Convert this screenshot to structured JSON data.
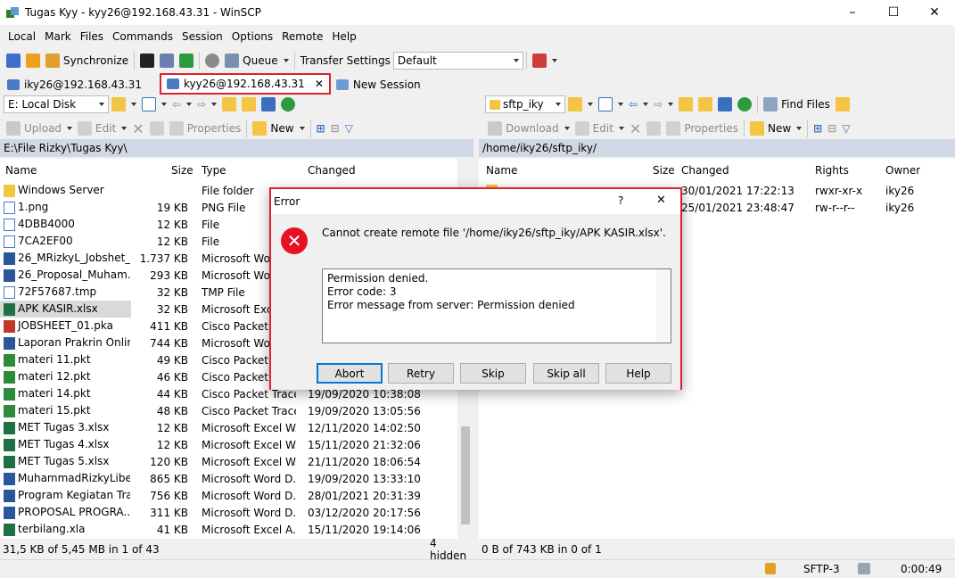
{
  "window": {
    "title": "Tugas Kyy - kyy26@192.168.43.31 - WinSCP",
    "minimize": "–",
    "maximize": "☐",
    "close": "✕"
  },
  "menu": [
    "Local",
    "Mark",
    "Files",
    "Commands",
    "Session",
    "Options",
    "Remote",
    "Help"
  ],
  "toolbar": {
    "synchronize": "Synchronize",
    "queue": "Queue",
    "transfer_settings_label": "Transfer Settings",
    "transfer_settings_value": "Default"
  },
  "tabs": [
    {
      "label": "iky26@192.168.43.31"
    },
    {
      "label": "kyy26@192.168.43.31",
      "close": "✕"
    },
    {
      "label": "New Session"
    }
  ],
  "local": {
    "drive": "E: Local Disk",
    "actions": {
      "upload": "Upload",
      "edit": "Edit",
      "properties": "Properties",
      "new": "New"
    },
    "path": "E:\\File Rizky\\Tugas Kyy\\",
    "columns": {
      "name": "Name",
      "size": "Size",
      "type": "Type",
      "changed": "Changed"
    },
    "files": [
      {
        "name": "Windows Server",
        "size": "",
        "type": "File folder",
        "changed": "",
        "icon": "folder"
      },
      {
        "name": "1.png",
        "size": "19 KB",
        "type": "PNG File",
        "changed": "",
        "icon": "doc"
      },
      {
        "name": "4DBB4000",
        "size": "12 KB",
        "type": "File",
        "changed": "",
        "icon": "doc"
      },
      {
        "name": "7CA2EF00",
        "size": "12 KB",
        "type": "File",
        "changed": "",
        "icon": "doc"
      },
      {
        "name": "26_MRizkyL_Jobshet_...",
        "size": "1.737 KB",
        "type": "Microsoft Word",
        "changed": "",
        "icon": "word"
      },
      {
        "name": "26_Proposal_Muham...",
        "size": "293 KB",
        "type": "Microsoft Word",
        "changed": "",
        "icon": "word"
      },
      {
        "name": "72F57687.tmp",
        "size": "32 KB",
        "type": "TMP File",
        "changed": "",
        "icon": "doc"
      },
      {
        "name": "APK KASIR.xlsx",
        "size": "32 KB",
        "type": "Microsoft Excel",
        "changed": "",
        "icon": "xls"
      },
      {
        "name": "JOBSHEET_01.pka",
        "size": "411 KB",
        "type": "Cisco Packet T",
        "changed": "",
        "icon": "pka"
      },
      {
        "name": "Laporan Prakrin Onlin...",
        "size": "744 KB",
        "type": "Microsoft Word",
        "changed": "",
        "icon": "word"
      },
      {
        "name": "materi 11.pkt",
        "size": "49 KB",
        "type": "Cisco Packet T",
        "changed": "",
        "icon": "pkt"
      },
      {
        "name": "materi 12.pkt",
        "size": "46 KB",
        "type": "Cisco Packet T",
        "changed": "",
        "icon": "pkt"
      },
      {
        "name": "materi 14.pkt",
        "size": "44 KB",
        "type": "Cisco Packet Tracer",
        "changed": "19/09/2020  10:38:08",
        "icon": "pkt"
      },
      {
        "name": "materi 15.pkt",
        "size": "48 KB",
        "type": "Cisco Packet Tracer",
        "changed": "19/09/2020  13:05:56",
        "icon": "pkt"
      },
      {
        "name": "MET Tugas 3.xlsx",
        "size": "12 KB",
        "type": "Microsoft Excel W...",
        "changed": "12/11/2020  14:02:50",
        "icon": "xls"
      },
      {
        "name": "MET Tugas 4.xlsx",
        "size": "12 KB",
        "type": "Microsoft Excel W...",
        "changed": "15/11/2020  21:32:06",
        "icon": "xls"
      },
      {
        "name": "MET Tugas 5.xlsx",
        "size": "120 KB",
        "type": "Microsoft Excel W...",
        "changed": "21/11/2020  18:06:54",
        "icon": "xls"
      },
      {
        "name": "MuhammadRizkyLibe...",
        "size": "865 KB",
        "type": "Microsoft Word D...",
        "changed": "19/09/2020  13:33:10",
        "icon": "word"
      },
      {
        "name": "Program Kegiatan Tra...",
        "size": "756 KB",
        "type": "Microsoft Word D...",
        "changed": "28/01/2021  20:31:39",
        "icon": "word"
      },
      {
        "name": "PROPOSAL PROGRA...",
        "size": "311 KB",
        "type": "Microsoft Word D...",
        "changed": "03/12/2020  20:17:56",
        "icon": "word"
      },
      {
        "name": "terbilang.xla",
        "size": "41 KB",
        "type": "Microsoft Excel A...",
        "changed": "15/11/2020  19:14:06",
        "icon": "xls"
      }
    ],
    "status": "31,5 KB of 5,45 MB in 1 of 43",
    "hidden": "4 hidden"
  },
  "remote": {
    "folder": "sftp_iky",
    "find_files": "Find Files",
    "actions": {
      "download": "Download",
      "edit": "Edit",
      "properties": "Properties",
      "new": "New"
    },
    "path": "/home/iky26/sftp_iky/",
    "columns": {
      "name": "Name",
      "size": "Size",
      "changed": "Changed",
      "rights": "Rights",
      "owner": "Owner"
    },
    "files": [
      {
        "changed": "30/01/2021 17:22:13",
        "rights": "rwxr-xr-x",
        "owner": "iky26"
      },
      {
        "changed": "25/01/2021 23:48:47",
        "rights": "rw-r--r--",
        "owner": "iky26"
      }
    ],
    "status": "0 B of 743 KB in 0 of 1"
  },
  "bottom": {
    "protocol": "SFTP-3",
    "time": "0:00:49"
  },
  "dialog": {
    "title": "Error",
    "help_glyph": "?",
    "close_glyph": "✕",
    "message": "Cannot create remote file '/home/iky26/sftp_iky/APK KASIR.xlsx'.",
    "details": [
      "Permission denied.",
      "Error code: 3",
      "Error message from server: Permission denied"
    ],
    "buttons": {
      "abort": "Abort",
      "retry": "Retry",
      "skip": "Skip",
      "skip_all": "Skip all",
      "help": "Help"
    }
  }
}
